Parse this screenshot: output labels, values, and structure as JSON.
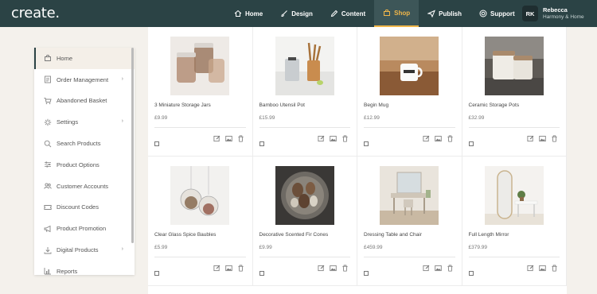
{
  "app": {
    "logo": "create."
  },
  "nav": [
    {
      "label": "Home",
      "icon": "home-icon"
    },
    {
      "label": "Design",
      "icon": "brush-icon"
    },
    {
      "label": "Content",
      "icon": "edit-icon"
    },
    {
      "label": "Shop",
      "icon": "shop-bag-icon",
      "active": true
    },
    {
      "label": "Publish",
      "icon": "send-icon"
    },
    {
      "label": "Support",
      "icon": "support-icon"
    }
  ],
  "user": {
    "initials": "RK",
    "name": "Rebecca",
    "shop": "Harmony & Home"
  },
  "sidebar": {
    "items": [
      {
        "label": "Home",
        "icon": "shop-bag-icon",
        "active": true
      },
      {
        "label": "Order Management",
        "icon": "orders-icon",
        "chevron": "›"
      },
      {
        "label": "Abandoned Basket",
        "icon": "basket-icon"
      },
      {
        "label": "Settings",
        "icon": "settings-icon",
        "chevron": "›"
      },
      {
        "label": "Search Products",
        "icon": "search-icon"
      },
      {
        "label": "Product Options",
        "icon": "sliders-icon"
      },
      {
        "label": "Customer Accounts",
        "icon": "users-icon"
      },
      {
        "label": "Discount Codes",
        "icon": "ticket-icon"
      },
      {
        "label": "Product Promotion",
        "icon": "megaphone-icon"
      },
      {
        "label": "Digital Products",
        "icon": "download-icon",
        "chevron": "›"
      },
      {
        "label": "Reports",
        "icon": "chart-icon"
      }
    ]
  },
  "products": [
    {
      "name": "3 Miniature Storage Jars",
      "price": "£9.99"
    },
    {
      "name": "Bamboo Utensil Pot",
      "price": "£15.99"
    },
    {
      "name": "Begin Mug",
      "price": "£12.99"
    },
    {
      "name": "Ceramic Storage Pots",
      "price": "£32.99"
    },
    {
      "name": "Clear Glass Spice Baubles",
      "price": "£5.99"
    },
    {
      "name": "Decorative Scented Fir Cones",
      "price": "£9.99"
    },
    {
      "name": "Dressing Table and Chair",
      "price": "£459.99"
    },
    {
      "name": "Full Length Mirror",
      "price": "£379.99"
    }
  ],
  "colors": {
    "topbar": "#2b4345",
    "accent": "#f0b64a",
    "background": "#f4f1ec"
  }
}
